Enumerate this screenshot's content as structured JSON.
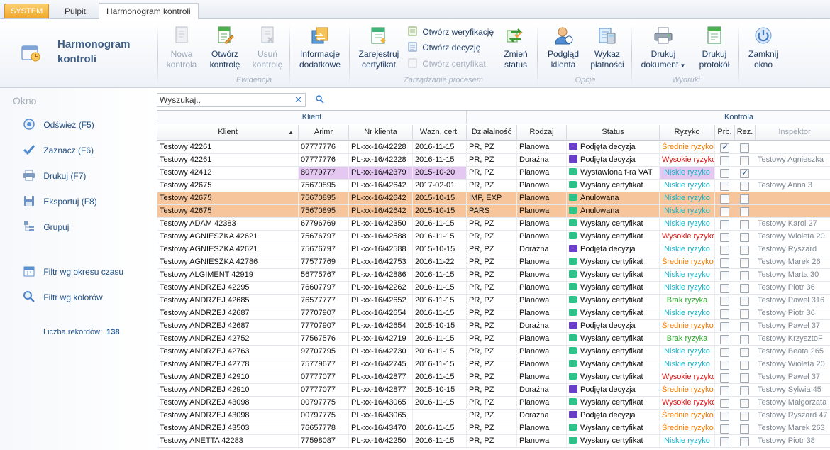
{
  "tabs": {
    "system": "SYSTEM",
    "pulpit": "Pulpit",
    "active": "Harmonogram kontroli"
  },
  "ribbon": {
    "brand_title": "Harmonogram kontroli",
    "nowa_kontrola": "Nowa kontrola",
    "otworz_kontrole": "Otwórz kontrolę",
    "usun_kontrole": "Usuń kontrolę",
    "informacje_dodatkowe": "Informacje dodatkowe",
    "group_ewidencja": "Ewidencja",
    "zarejestruj_certyfikat": "Zarejestruj certyfikat",
    "otworz_weryfikacje": "Otwórz weryfikację",
    "otworz_decyzje": "Otwórz decyzję",
    "otworz_certyfikat": "Otwórz certyfikat",
    "zmien_status": "Zmień status",
    "group_zarzadzanie": "Zarządzanie procesem",
    "podglad_klienta": "Podgląd klienta",
    "wykaz_platnosci": "Wykaz płatności",
    "group_opcje": "Opcje",
    "drukuj_dokument": "Drukuj dokument",
    "drukuj_protokol": "Drukuj protokół",
    "group_wydruki": "Wydruki",
    "zamknij_okno": "Zamknij okno"
  },
  "sidebar": {
    "header": "Okno",
    "items": [
      {
        "label": "Odśwież",
        "key": "(F5)"
      },
      {
        "label": "Zaznacz",
        "key": "(F6)"
      },
      {
        "label": "Drukuj",
        "key": "(F7)"
      },
      {
        "label": "Eksportuj",
        "key": "(F8)"
      },
      {
        "label": "Grupuj",
        "key": ""
      }
    ],
    "filter_period": "Filtr wg okresu czasu",
    "filter_colors": "Filtr wg kolorów",
    "records_label": "Liczba rekordów:",
    "records_count": "138"
  },
  "search": {
    "placeholder": "Wyszukaj.."
  },
  "grid": {
    "band_klient": "Klient",
    "band_kontrola": "Kontrola",
    "columns": [
      "Klient",
      "Arimr",
      "Nr klienta",
      "Ważn. cert.",
      "Działalność",
      "Rodzaj",
      "Status",
      "Ryzyko",
      "Prb.",
      "Rez.",
      "Inspektor"
    ],
    "risk_colors": {
      "Średnie ryzyko": "#f07800",
      "Wysokie ryzyko": "#e01010",
      "Niskie ryzyko": "#18b4c8",
      "Brak ryzyka": "#2aa82a"
    },
    "status_colors": {
      "Podjęta decyzja": "#6a3fc8",
      "Wysłany certyfikat": "#2ec28a",
      "Wystawiona f-ra VAT": "#2ec28a",
      "Anulowana": "#2ec28a"
    },
    "rows": [
      {
        "klient": "Testowy   42261",
        "arimr": "07777776",
        "nr": "PL-xx-16/42228",
        "cert": "2016-11-15",
        "dzial": "PR, PZ",
        "rodzaj": "Planowa",
        "status": "Podjęta decyzja",
        "ryzyko": "Średnie ryzyko",
        "prb": true,
        "rez": false,
        "insp": "",
        "hl": ""
      },
      {
        "klient": "Testowy   42261",
        "arimr": "07777776",
        "nr": "PL-xx-16/42228",
        "cert": "2016-11-15",
        "dzial": "PR, PZ",
        "rodzaj": "Doraźna",
        "status": "Podjęta decyzja",
        "ryzyko": "Wysokie ryzyko",
        "prb": false,
        "rez": false,
        "insp": "Testowy Agnieszka",
        "hl": ""
      },
      {
        "klient": "Testowy  42412",
        "arimr": "80779777",
        "nr": "PL-xx-16/42379",
        "cert": "2015-10-20",
        "dzial": "PR, PZ",
        "rodzaj": "Planowa",
        "status": "Wystawiona f-ra VAT",
        "ryzyko": "Niskie ryzyko",
        "prb": false,
        "rez": true,
        "insp": "",
        "hl": "purple"
      },
      {
        "klient": "Testowy  42675",
        "arimr": "75670895",
        "nr": "PL-xx-16/42642",
        "cert": "2017-02-01",
        "dzial": "PR, PZ",
        "rodzaj": "Planowa",
        "status": "Wysłany certyfikat",
        "ryzyko": "Niskie ryzyko",
        "prb": false,
        "rez": false,
        "insp": "Testowy Anna  3",
        "hl": ""
      },
      {
        "klient": "Testowy  42675",
        "arimr": "75670895",
        "nr": "PL-xx-16/42642",
        "cert": "2015-10-15",
        "dzial": "IMP, EXP",
        "rodzaj": "Planowa",
        "status": "Anulowana",
        "ryzyko": "Niskie ryzyko",
        "prb": false,
        "rez": false,
        "insp": "",
        "hl": "orange"
      },
      {
        "klient": "Testowy  42675",
        "arimr": "75670895",
        "nr": "PL-xx-16/42642",
        "cert": "2015-10-15",
        "dzial": "PARS",
        "rodzaj": "Planowa",
        "status": "Anulowana",
        "ryzyko": "Niskie ryzyko",
        "prb": false,
        "rez": false,
        "insp": "",
        "hl": "orange"
      },
      {
        "klient": "Testowy ADAM 42383",
        "arimr": "67796769",
        "nr": "PL-xx-16/42350",
        "cert": "2016-11-15",
        "dzial": "PR, PZ",
        "rodzaj": "Planowa",
        "status": "Wysłany certyfikat",
        "ryzyko": "Niskie ryzyko",
        "prb": false,
        "rez": false,
        "insp": "Testowy Karol 27",
        "hl": ""
      },
      {
        "klient": "Testowy AGNIESZKA 42621",
        "arimr": "75676797",
        "nr": "PL-xx-16/42588",
        "cert": "2016-11-15",
        "dzial": "PR, PZ",
        "rodzaj": "Planowa",
        "status": "Wysłany certyfikat",
        "ryzyko": "Wysokie ryzyko",
        "prb": false,
        "rez": false,
        "insp": "Testowy Wioleta 20",
        "hl": ""
      },
      {
        "klient": "Testowy AGNIESZKA 42621",
        "arimr": "75676797",
        "nr": "PL-xx-16/42588",
        "cert": "2015-10-15",
        "dzial": "PR, PZ",
        "rodzaj": "Doraźna",
        "status": "Podjęta decyzja",
        "ryzyko": "Niskie ryzyko",
        "prb": false,
        "rez": false,
        "insp": "Testowy Ryszard",
        "hl": ""
      },
      {
        "klient": "Testowy AGNIESZKA 42786",
        "arimr": "77577769",
        "nr": "PL-xx-16/42753",
        "cert": "2016-11-22",
        "dzial": "PR, PZ",
        "rodzaj": "Planowa",
        "status": "Wysłany certyfikat",
        "ryzyko": "Średnie ryzyko",
        "prb": false,
        "rez": false,
        "insp": "Testowy Marek 26",
        "hl": ""
      },
      {
        "klient": "Testowy ALGIMENT 42919",
        "arimr": "56775767",
        "nr": "PL-xx-16/42886",
        "cert": "2016-11-15",
        "dzial": "PR, PZ",
        "rodzaj": "Planowa",
        "status": "Wysłany certyfikat",
        "ryzyko": "Niskie ryzyko",
        "prb": false,
        "rez": false,
        "insp": "Testowy Marta  30",
        "hl": ""
      },
      {
        "klient": "Testowy ANDRZEJ 42295",
        "arimr": "76607797",
        "nr": "PL-xx-16/42262",
        "cert": "2016-11-15",
        "dzial": "PR, PZ",
        "rodzaj": "Planowa",
        "status": "Wysłany certyfikat",
        "ryzyko": "Niskie ryzyko",
        "prb": false,
        "rez": false,
        "insp": "Testowy Piotr  36",
        "hl": ""
      },
      {
        "klient": "Testowy ANDRZEJ 42685",
        "arimr": "76577777",
        "nr": "PL-xx-16/42652",
        "cert": "2016-11-15",
        "dzial": "PR, PZ",
        "rodzaj": "Planowa",
        "status": "Wysłany certyfikat",
        "ryzyko": "Brak ryzyka",
        "prb": false,
        "rez": false,
        "insp": "Testowy Paweł 316",
        "hl": ""
      },
      {
        "klient": "Testowy ANDRZEJ 42687",
        "arimr": "77707907",
        "nr": "PL-xx-16/42654",
        "cert": "2016-11-15",
        "dzial": "PR, PZ",
        "rodzaj": "Planowa",
        "status": "Wysłany certyfikat",
        "ryzyko": "Niskie ryzyko",
        "prb": false,
        "rez": false,
        "insp": "Testowy Piotr  36",
        "hl": ""
      },
      {
        "klient": "Testowy ANDRZEJ 42687",
        "arimr": "77707907",
        "nr": "PL-xx-16/42654",
        "cert": "2015-10-15",
        "dzial": "PR, PZ",
        "rodzaj": "Doraźna",
        "status": "Podjęta decyzja",
        "ryzyko": "Średnie ryzyko",
        "prb": false,
        "rez": false,
        "insp": "Testowy Paweł 37",
        "hl": ""
      },
      {
        "klient": "Testowy ANDRZEJ 42752",
        "arimr": "77567576",
        "nr": "PL-xx-16/42719",
        "cert": "2016-11-15",
        "dzial": "PR, PZ",
        "rodzaj": "Planowa",
        "status": "Wysłany certyfikat",
        "ryzyko": "Brak ryzyka",
        "prb": false,
        "rez": false,
        "insp": "Testowy KrzysztoF",
        "hl": ""
      },
      {
        "klient": "Testowy ANDRZEJ 42763",
        "arimr": "97707795",
        "nr": "PL-xx-16/42730",
        "cert": "2016-11-15",
        "dzial": "PR, PZ",
        "rodzaj": "Planowa",
        "status": "Wysłany certyfikat",
        "ryzyko": "Niskie ryzyko",
        "prb": false,
        "rez": false,
        "insp": "Testowy Beata 265",
        "hl": ""
      },
      {
        "klient": "Testowy ANDRZEJ 42778",
        "arimr": "75779677",
        "nr": "PL-xx-16/42745",
        "cert": "2016-11-15",
        "dzial": "PR, PZ",
        "rodzaj": "Planowa",
        "status": "Wysłany certyfikat",
        "ryzyko": "Niskie ryzyko",
        "prb": false,
        "rez": false,
        "insp": "Testowy Wioleta 20",
        "hl": ""
      },
      {
        "klient": "Testowy ANDRZEJ 42910",
        "arimr": "07777077",
        "nr": "PL-xx-16/42877",
        "cert": "2016-11-15",
        "dzial": "PR, PZ",
        "rodzaj": "Planowa",
        "status": "Wysłany certyfikat",
        "ryzyko": "Wysokie ryzyko",
        "prb": false,
        "rez": false,
        "insp": "Testowy Paweł 37",
        "hl": ""
      },
      {
        "klient": "Testowy ANDRZEJ 42910",
        "arimr": "07777077",
        "nr": "PL-xx-16/42877",
        "cert": "2015-10-15",
        "dzial": "PR, PZ",
        "rodzaj": "Doraźna",
        "status": "Podjęta decyzja",
        "ryzyko": "Średnie ryzyko",
        "prb": false,
        "rez": false,
        "insp": "Testowy Sylwia  45",
        "hl": ""
      },
      {
        "klient": "Testowy ANDRZEJ 43098",
        "arimr": "00797775",
        "nr": "PL-xx-16/43065",
        "cert": "2016-11-15",
        "dzial": "PR, PZ",
        "rodzaj": "Planowa",
        "status": "Wysłany certyfikat",
        "ryzyko": "Wysokie ryzyko",
        "prb": false,
        "rez": false,
        "insp": "Testowy Małgorzata",
        "hl": ""
      },
      {
        "klient": "Testowy ANDRZEJ 43098",
        "arimr": "00797775",
        "nr": "PL-xx-16/43065",
        "cert": "",
        "dzial": "PR, PZ",
        "rodzaj": "Doraźna",
        "status": "Podjęta decyzja",
        "ryzyko": "Średnie ryzyko",
        "prb": false,
        "rez": false,
        "insp": "Testowy Ryszard  47",
        "hl": ""
      },
      {
        "klient": "Testowy ANDRZEJ 43503",
        "arimr": "76657778",
        "nr": "PL-xx-16/43470",
        "cert": "2016-11-15",
        "dzial": "PR, PZ",
        "rodzaj": "Planowa",
        "status": "Wysłany certyfikat",
        "ryzyko": "Średnie ryzyko",
        "prb": false,
        "rez": false,
        "insp": "Testowy Marek 263",
        "hl": ""
      },
      {
        "klient": "Testowy ANETTA 42283",
        "arimr": "77598087",
        "nr": "PL-xx-16/42250",
        "cert": "2016-11-15",
        "dzial": "PR, PZ",
        "rodzaj": "Planowa",
        "status": "Wysłany certyfikat",
        "ryzyko": "Niskie ryzyko",
        "prb": false,
        "rez": false,
        "insp": "Testowy Piotr  38",
        "hl": ""
      }
    ]
  }
}
